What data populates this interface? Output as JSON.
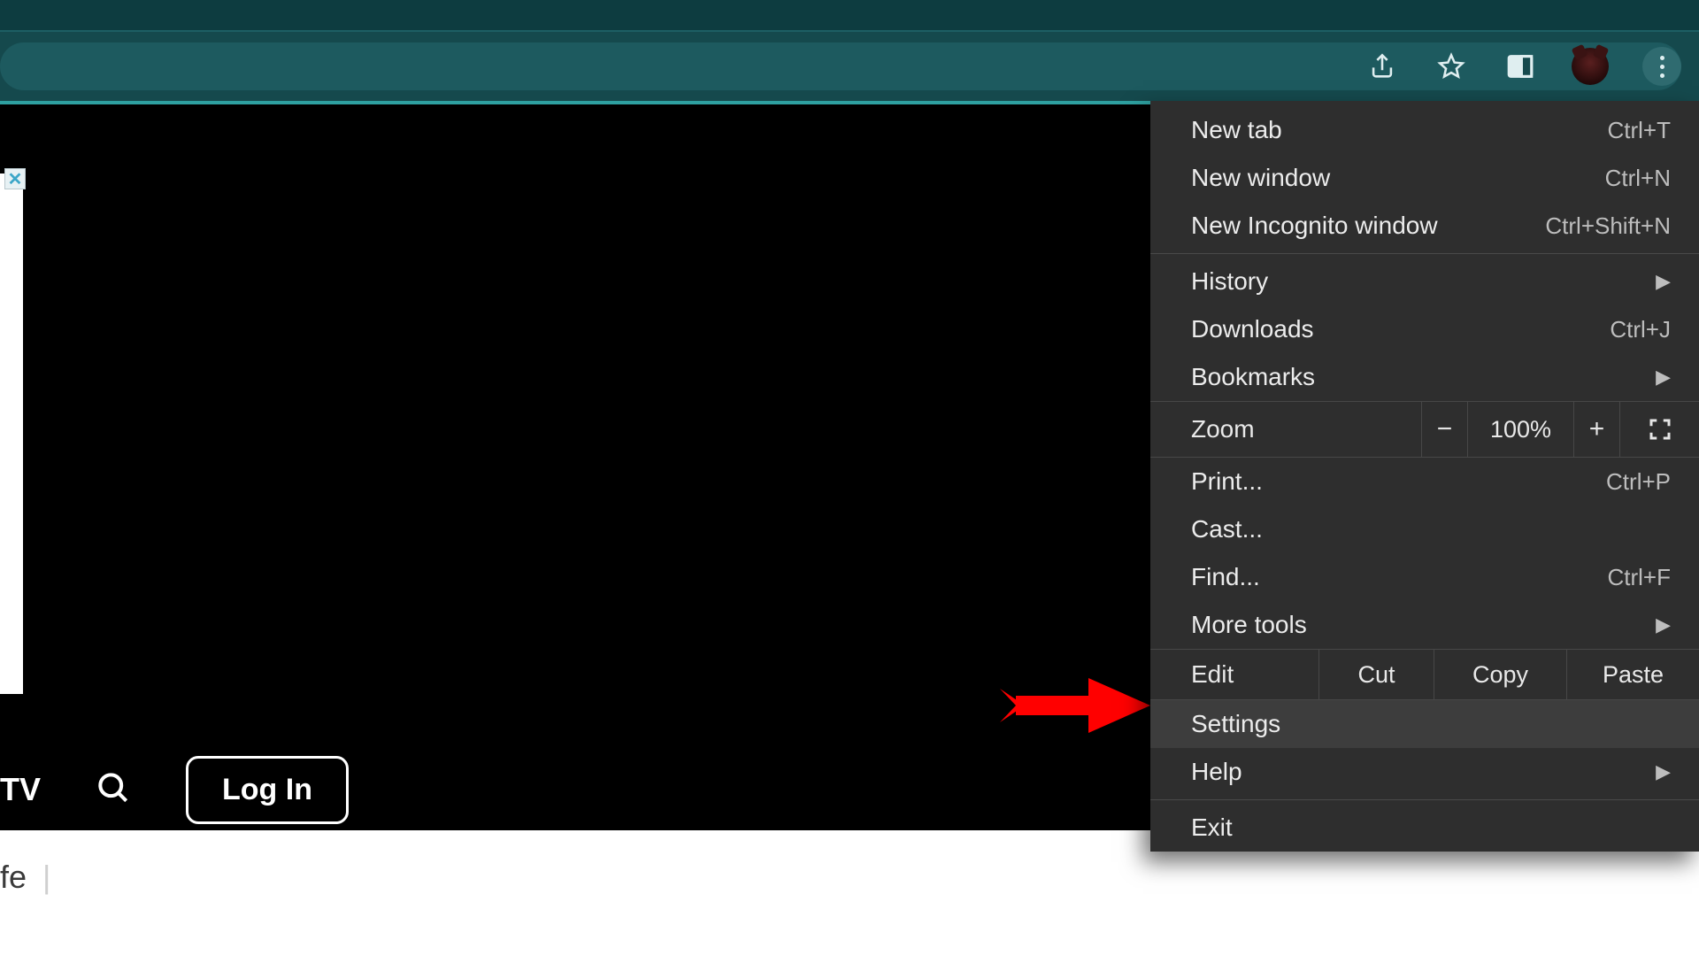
{
  "toolbar": {
    "icons": {
      "share": "share-icon",
      "bookmark": "star-icon",
      "sidepanel": "sidepanel-icon",
      "profile": "profile-avatar",
      "kebab": "menu-kebab-icon"
    }
  },
  "site": {
    "tv_label": "TV",
    "login_label": "Log In",
    "fragment": "fe",
    "ad_close": "✕"
  },
  "menu": {
    "items": [
      {
        "label": "New tab",
        "shortcut": "Ctrl+T"
      },
      {
        "label": "New window",
        "shortcut": "Ctrl+N"
      },
      {
        "label": "New Incognito window",
        "shortcut": "Ctrl+Shift+N"
      }
    ],
    "items2": [
      {
        "label": "History",
        "submenu": true
      },
      {
        "label": "Downloads",
        "shortcut": "Ctrl+J"
      },
      {
        "label": "Bookmarks",
        "submenu": true
      }
    ],
    "zoom": {
      "label": "Zoom",
      "pct": "100%",
      "minus": "−",
      "plus": "+"
    },
    "items3": [
      {
        "label": "Print...",
        "shortcut": "Ctrl+P"
      },
      {
        "label": "Cast..."
      },
      {
        "label": "Find...",
        "shortcut": "Ctrl+F"
      },
      {
        "label": "More tools",
        "submenu": true
      }
    ],
    "edit": {
      "label": "Edit",
      "cut": "Cut",
      "copy": "Copy",
      "paste": "Paste"
    },
    "items4": [
      {
        "label": "Settings",
        "highlight": true
      },
      {
        "label": "Help",
        "submenu": true
      }
    ],
    "exit": {
      "label": "Exit"
    }
  }
}
